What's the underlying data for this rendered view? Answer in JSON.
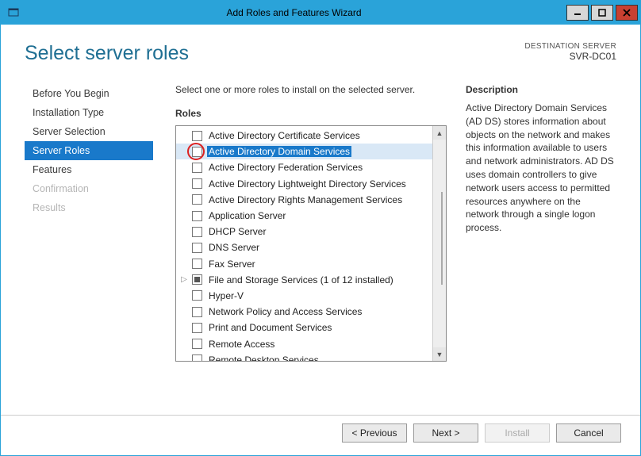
{
  "window": {
    "title": "Add Roles and Features Wizard"
  },
  "header": {
    "page_title": "Select server roles",
    "dest_label": "DESTINATION SERVER",
    "dest_name": "SVR-DC01"
  },
  "nav": {
    "items": [
      {
        "label": "Before You Begin",
        "state": "normal"
      },
      {
        "label": "Installation Type",
        "state": "normal"
      },
      {
        "label": "Server Selection",
        "state": "normal"
      },
      {
        "label": "Server Roles",
        "state": "active"
      },
      {
        "label": "Features",
        "state": "normal"
      },
      {
        "label": "Confirmation",
        "state": "disabled"
      },
      {
        "label": "Results",
        "state": "disabled"
      }
    ]
  },
  "center": {
    "instruction": "Select one or more roles to install on the selected server.",
    "roles_label": "Roles",
    "roles": [
      {
        "label": "Active Directory Certificate Services"
      },
      {
        "label": "Active Directory Domain Services",
        "selected": true,
        "circled": true
      },
      {
        "label": "Active Directory Federation Services"
      },
      {
        "label": "Active Directory Lightweight Directory Services"
      },
      {
        "label": "Active Directory Rights Management Services"
      },
      {
        "label": "Application Server"
      },
      {
        "label": "DHCP Server"
      },
      {
        "label": "DNS Server"
      },
      {
        "label": "Fax Server"
      },
      {
        "label": "File and Storage Services (1 of 12 installed)",
        "expandable": true,
        "filled": true
      },
      {
        "label": "Hyper-V"
      },
      {
        "label": "Network Policy and Access Services"
      },
      {
        "label": "Print and Document Services"
      },
      {
        "label": "Remote Access"
      },
      {
        "label": "Remote Desktop Services"
      }
    ]
  },
  "description": {
    "label": "Description",
    "text": "Active Directory Domain Services (AD DS) stores information about objects on the network and makes this information available to users and network administrators. AD DS uses domain controllers to give network users access to permitted resources anywhere on the network through a single logon process."
  },
  "footer": {
    "previous": "< Previous",
    "next": "Next >",
    "install": "Install",
    "cancel": "Cancel"
  }
}
